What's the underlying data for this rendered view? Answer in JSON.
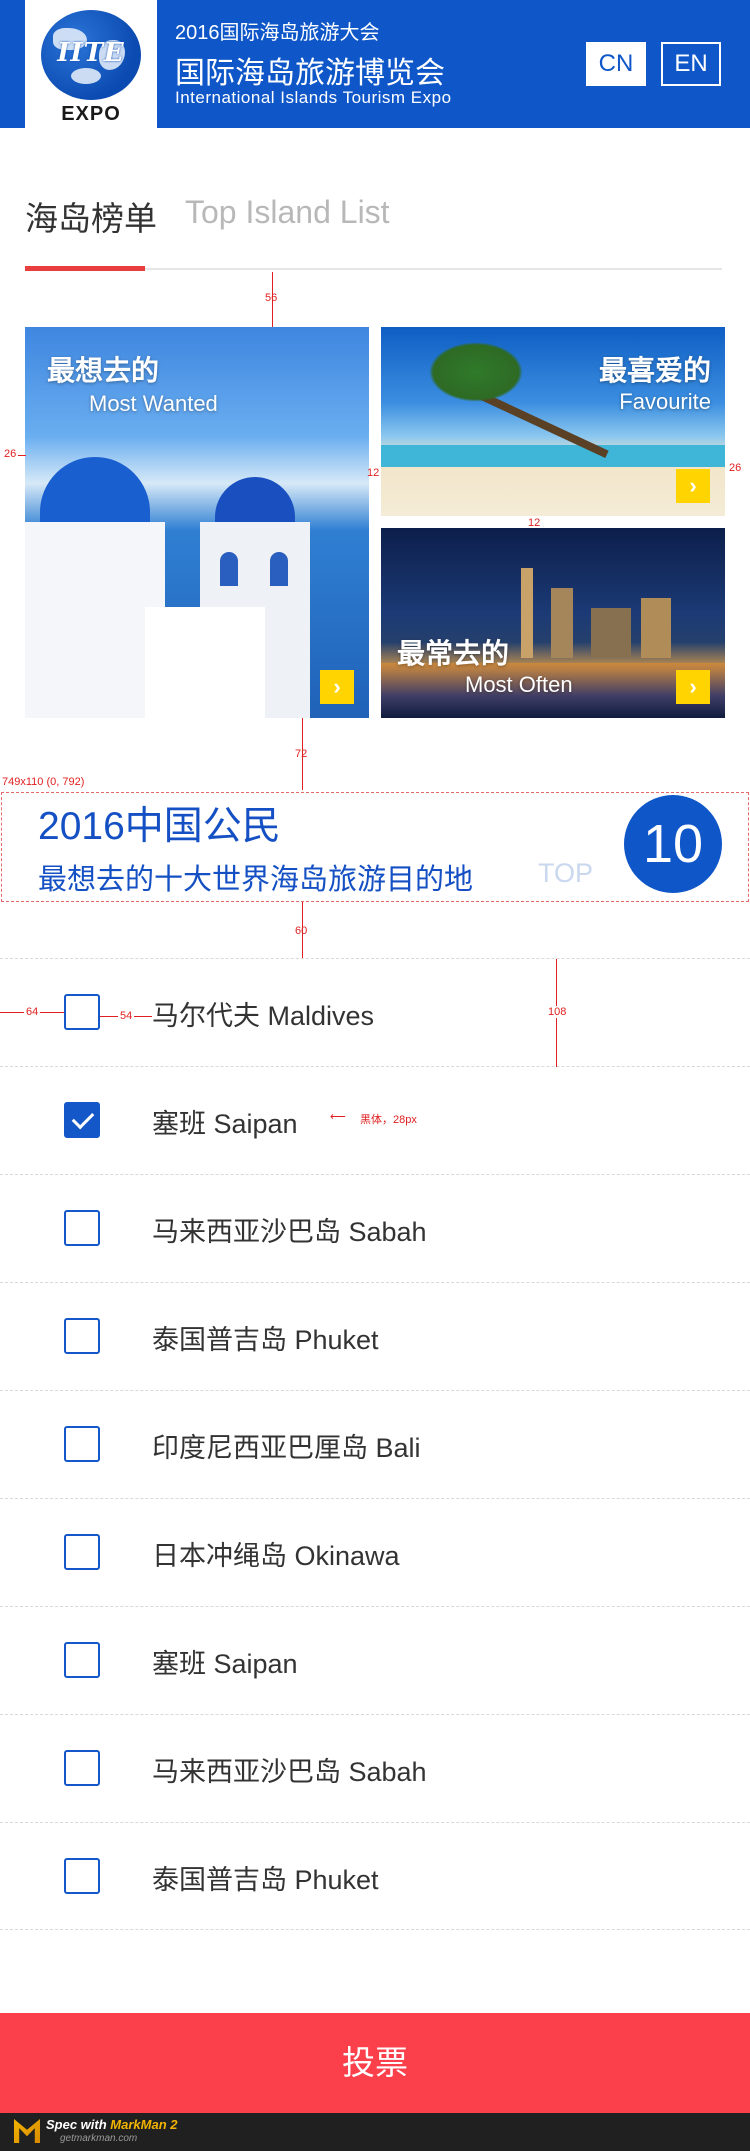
{
  "header": {
    "logo_text": "EXPO",
    "logo_mark": "IITE",
    "line1": "2016国际海岛旅游大会",
    "line2": "国际海岛旅游博览会",
    "line3": "International Islands Tourism Expo",
    "lang_cn": "CN",
    "lang_en": "EN"
  },
  "section": {
    "title_cn": "海岛榜单",
    "title_en": "Top Island List"
  },
  "cards": {
    "wanted": {
      "title": "最想去的",
      "subtitle": "Most Wanted",
      "arrow": "›"
    },
    "favourite": {
      "title": "最喜爱的",
      "subtitle": "Favourite",
      "arrow": "›"
    },
    "often": {
      "title": "最常去的",
      "subtitle": "Most Often",
      "arrow": "›"
    }
  },
  "banner": {
    "title1": "2016中国公民",
    "title2": "最想去的十大世界海岛旅游目的地",
    "top_label": "TOP",
    "number": "10"
  },
  "islands": [
    {
      "label": "马尔代夫 Maldives",
      "checked": false
    },
    {
      "label": "塞班 Saipan",
      "checked": true
    },
    {
      "label": "马来西亚沙巴岛 Sabah",
      "checked": false
    },
    {
      "label": "泰国普吉岛 Phuket",
      "checked": false
    },
    {
      "label": "印度尼西亚巴厘岛 Bali",
      "checked": false
    },
    {
      "label": "日本冲绳岛 Okinawa",
      "checked": false
    },
    {
      "label": "塞班 Saipan",
      "checked": false
    },
    {
      "label": "马来西亚沙巴岛 Sabah",
      "checked": false
    },
    {
      "label": "泰国普吉岛 Phuket",
      "checked": false
    }
  ],
  "vote_label": "投票",
  "annotations": {
    "a56": "56",
    "a26_left": "26",
    "a12_v": "12",
    "a26_right": "26",
    "a12_h": "12",
    "a72": "72",
    "box": "749x110 (0, 792)",
    "a60": "60",
    "a64": "64",
    "a54": "54",
    "a108": "108",
    "font_note": "黑体，28px"
  },
  "footer": {
    "spec_with": "Spec with ",
    "brand": "MarkMan 2",
    "site": "getmarkman.com"
  },
  "colors": {
    "header_blue": "#0f57c8",
    "accent_red": "#e93e3e",
    "vote_red": "#fb404b",
    "arrow_yellow": "#ffd400",
    "checkbox_blue": "#1457c8"
  }
}
